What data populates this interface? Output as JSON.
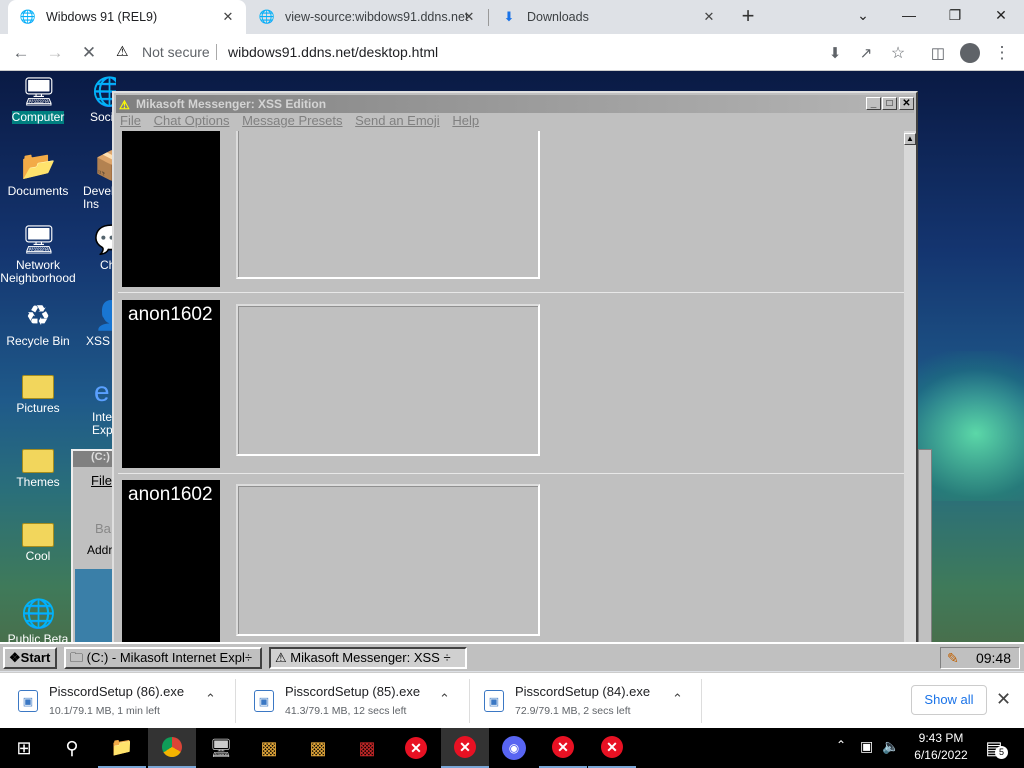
{
  "browser": {
    "tabs": [
      {
        "title": "Wibdows 91 (REL9)",
        "icon": "globe-icon",
        "active": true
      },
      {
        "title": "view-source:wibdows91.ddns.net",
        "icon": "globe-icon",
        "active": false
      },
      {
        "title": "Downloads",
        "icon": "download-icon",
        "active": false
      }
    ],
    "new_tab": "+",
    "address": {
      "security_label": "Not secure",
      "url": "wibdows91.ddns.net/desktop.html"
    }
  },
  "desktop": {
    "icons_left": [
      {
        "label": "Computer",
        "icon": "computer-icon"
      },
      {
        "label": "Documents",
        "icon": "documents-icon"
      },
      {
        "label": "Network Neighborhood",
        "icon": "network-icon"
      },
      {
        "label": "Recycle Bin",
        "icon": "recycle-bin-icon"
      },
      {
        "label": "Pictures",
        "icon": "folder-icon"
      },
      {
        "label": "Themes",
        "icon": "folder-icon"
      },
      {
        "label": "Cool",
        "icon": "folder-icon"
      },
      {
        "label": "Public Beta",
        "icon": "globe-icon"
      }
    ],
    "icons_second_col": [
      {
        "label": "Soci",
        "icon": "globe-icon"
      },
      {
        "label": "Devel Ins",
        "icon": "installer-icon"
      },
      {
        "label": "Ch",
        "icon": "chat-icon"
      },
      {
        "label": "XSS",
        "icon": "messenger-icon"
      },
      {
        "label": "Inte Expl",
        "icon": "ie-icon"
      }
    ],
    "explorer_window": {
      "title": "(C:)",
      "menu_file": "File",
      "back_label": "Ba",
      "address_label": "Addr"
    }
  },
  "messenger": {
    "title": "Mikasoft Messenger: XSS Edition",
    "menu": [
      "File",
      "Chat Options",
      "Message Presets",
      "Send an Emoji",
      "Help"
    ],
    "messages": [
      {
        "user": "anon1602",
        "text": ""
      },
      {
        "user": "anon1602",
        "text": ""
      },
      {
        "user": "anon1602",
        "text": ""
      }
    ]
  },
  "w91_taskbar": {
    "start": "Start",
    "items": [
      "(C:) - Mikasoft Internet Expl÷",
      "Mikasoft Messenger: XSS ÷"
    ],
    "clock": "09:48"
  },
  "downloads": {
    "items": [
      {
        "name": "PisscordSetup (86).exe",
        "status": "10.1/79.1 MB, 1 min left"
      },
      {
        "name": "PisscordSetup (85).exe",
        "status": "41.3/79.1 MB, 12 secs left"
      },
      {
        "name": "PisscordSetup (84).exe",
        "status": "72.9/79.1 MB, 2 secs left"
      }
    ],
    "show_all": "Show all"
  },
  "w10_taskbar": {
    "time": "9:43 PM",
    "date": "6/16/2022",
    "notification_count": "5"
  }
}
